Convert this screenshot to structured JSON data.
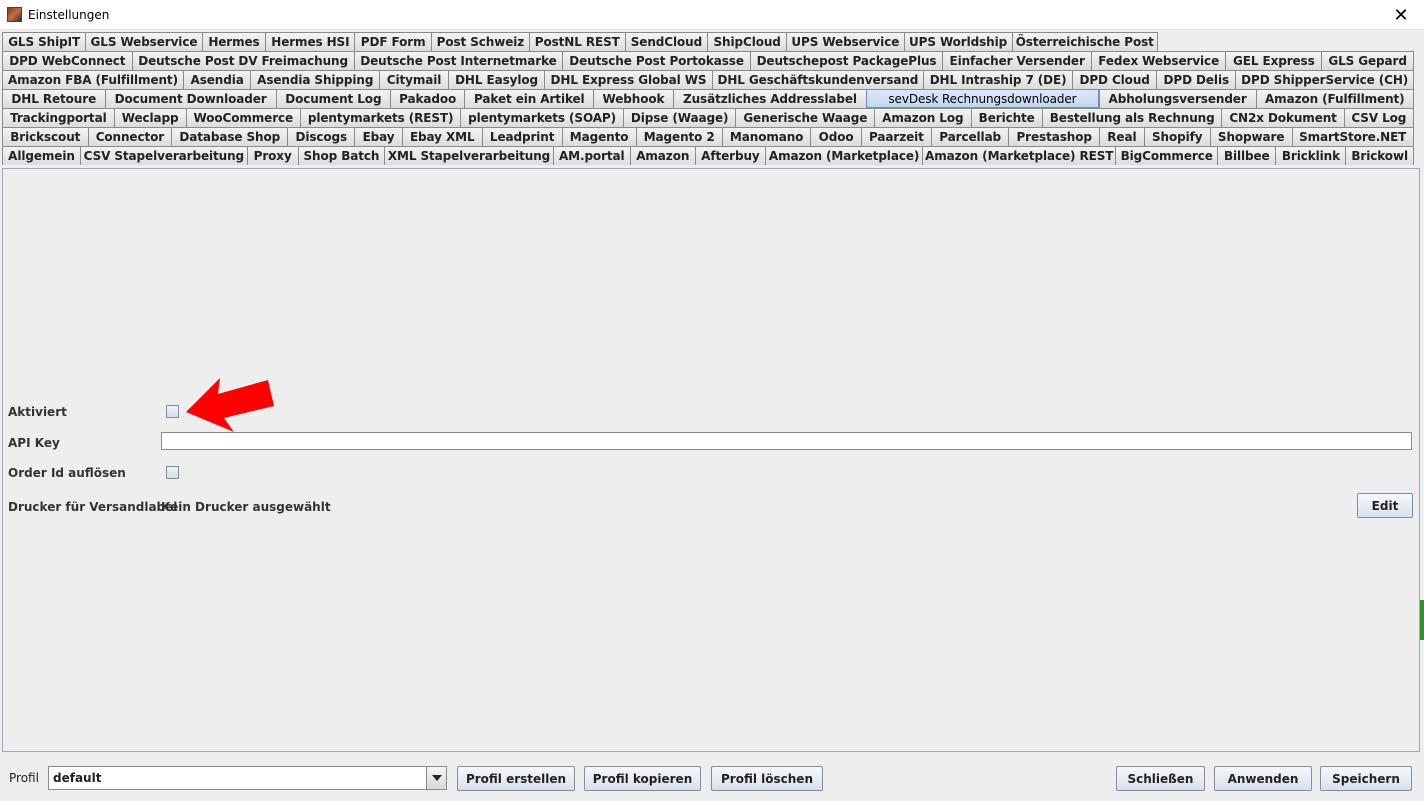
{
  "window": {
    "title": "Einstellungen",
    "close_glyph": "✕"
  },
  "tab_rows": [
    [
      "GLS ShipIT",
      "GLS Webservice",
      "Hermes",
      "Hermes HSI",
      "PDF Form",
      "Post Schweiz",
      "PostNL REST",
      "SendCloud",
      "ShipCloud",
      "UPS Webservice",
      "UPS Worldship",
      "Österreichische Post"
    ],
    [
      "DPD WebConnect",
      "Deutsche Post DV Freimachung",
      "Deutsche Post Internetmarke",
      "Deutsche Post Portokasse",
      "Deutschepost PackagePlus",
      "Einfacher Versender",
      "Fedex Webservice",
      "GEL Express",
      "GLS Gepard"
    ],
    [
      "Amazon FBA (Fulfillment)",
      "Asendia",
      "Asendia Shipping",
      "Citymail",
      "DHL Easylog",
      "DHL Express Global WS",
      "DHL Geschäftskundenversand",
      "DHL Intraship 7 (DE)",
      "DPD Cloud",
      "DPD Delis",
      "DPD ShipperService (CH)"
    ],
    [
      "DHL Retoure",
      "Document Downloader",
      "Document Log",
      "Pakadoo",
      "Paket ein Artikel",
      "Webhook",
      "Zusätzliches Addresslabel",
      "sevDesk Rechnungsdownloader",
      "Abholungsversender",
      "Amazon (Fulfillment)"
    ],
    [
      "Trackingportal",
      "Weclapp",
      "WooCommerce",
      "plentymarkets (REST)",
      "plentymarkets (SOAP)",
      "Dipse (Waage)",
      "Generische Waage",
      "Amazon Log",
      "Berichte",
      "Bestellung als Rechnung",
      "CN2x Dokument",
      "CSV Log"
    ],
    [
      "Brickscout",
      "Connector",
      "Database Shop",
      "Discogs",
      "Ebay",
      "Ebay XML",
      "Leadprint",
      "Magento",
      "Magento 2",
      "Manomano",
      "Odoo",
      "Paarzeit",
      "Parcellab",
      "Prestashop",
      "Real",
      "Shopify",
      "Shopware",
      "SmartStore.NET"
    ],
    [
      "Allgemein",
      "CSV Stapelverarbeitung",
      "Proxy",
      "Shop Batch",
      "XML Stapelverarbeitung",
      "AM.portal",
      "Amazon",
      "Afterbuy",
      "Amazon (Marketplace)",
      "Amazon (Marketplace) REST",
      "BigCommerce",
      "Billbee",
      "Bricklink",
      "Brickowl"
    ]
  ],
  "selected_tab": "sevDesk Rechnungsdownloader",
  "form": {
    "aktiviert_label": "Aktiviert",
    "aktiviert_checked": false,
    "api_key_label": "API Key",
    "api_key_value": "",
    "order_id_label": "Order Id auflösen",
    "order_id_checked": false,
    "drucker_label": "Drucker für Versandlabel",
    "drucker_value": "Kein Drucker ausgewählt",
    "edit_label": "Edit"
  },
  "annotation": {
    "arrow_color": "#ff0000"
  },
  "footer": {
    "profil_label": "Profil",
    "profil_value": "default",
    "profil_erstellen": "Profil erstellen",
    "profil_kopieren": "Profil kopieren",
    "profil_loeschen": "Profil löschen",
    "schliessen": "Schließen",
    "anwenden": "Anwenden",
    "speichern": "Speichern"
  }
}
